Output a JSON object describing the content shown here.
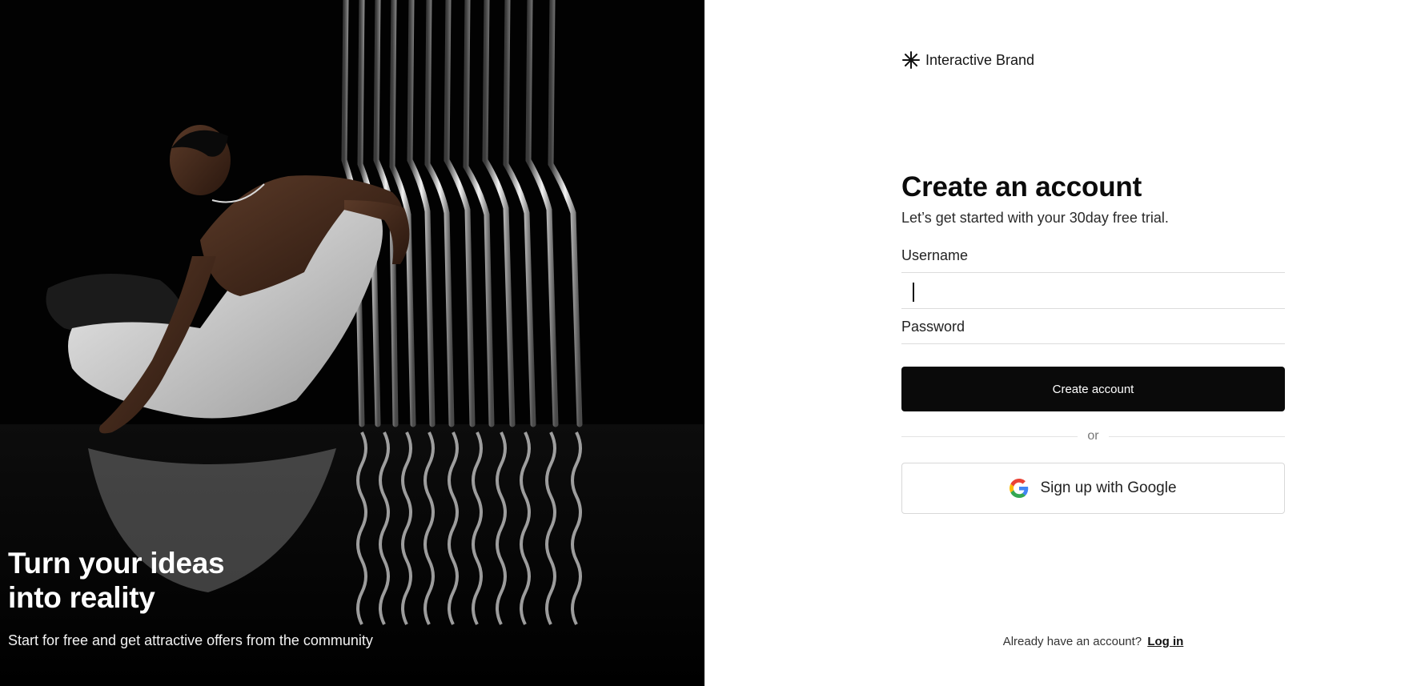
{
  "hero": {
    "title_line1": "Turn your ideas",
    "title_line2": "into reality",
    "subtitle": "Start for free and get attractive offers from the community",
    "image_icon": "photo-of-person-on-chair-with-metal-rods"
  },
  "brand": {
    "name": "Interactive Brand",
    "icon": "asterisk-icon"
  },
  "form": {
    "title": "Create an account",
    "subtitle": "Let’s get started with your 30day free trial.",
    "username_label": "Username",
    "username_value": "",
    "password_label": "Password",
    "password_value": "",
    "submit_label": "Create account",
    "divider_text": "or",
    "google_label": "Sign up with Google",
    "google_icon": "google-icon"
  },
  "footer": {
    "prompt": "Already have an account?",
    "login_label": "Log in"
  },
  "colors": {
    "primary": "#0a0a0a",
    "hero_bg": "#000000",
    "border": "#dcdcdc"
  }
}
